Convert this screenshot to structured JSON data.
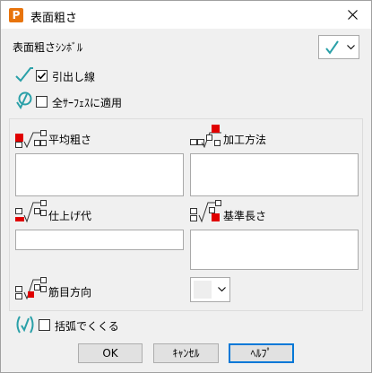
{
  "window": {
    "title": "表面粗さ",
    "app_icon_letter": "P"
  },
  "symbol": {
    "label": "表面粗さｼﾝﾎﾞﾙ",
    "selected_symbol": "√"
  },
  "leader": {
    "label": "引出し線",
    "checked": true
  },
  "all_surfaces": {
    "label": "全ｻｰﾌｪｽに適用",
    "checked": false
  },
  "fields": {
    "avg_roughness_label": "平均粗さ",
    "machining_method_label": "加工方法",
    "finish_allowance_label": "仕上げ代",
    "reference_length_label": "基準長さ",
    "lay_direction_label": "筋目方向"
  },
  "parentheses": {
    "label": "括弧でくくる",
    "checked": false
  },
  "buttons": {
    "ok": "OK",
    "cancel": "ｷｬﾝｾﾙ",
    "help": "ﾍﾙﾌﾟ"
  },
  "colors": {
    "accent": "#0078d7",
    "highlight_red": "#e00000",
    "symbol_teal": "#2aa0a8",
    "brand_orange": "#e8740c"
  }
}
